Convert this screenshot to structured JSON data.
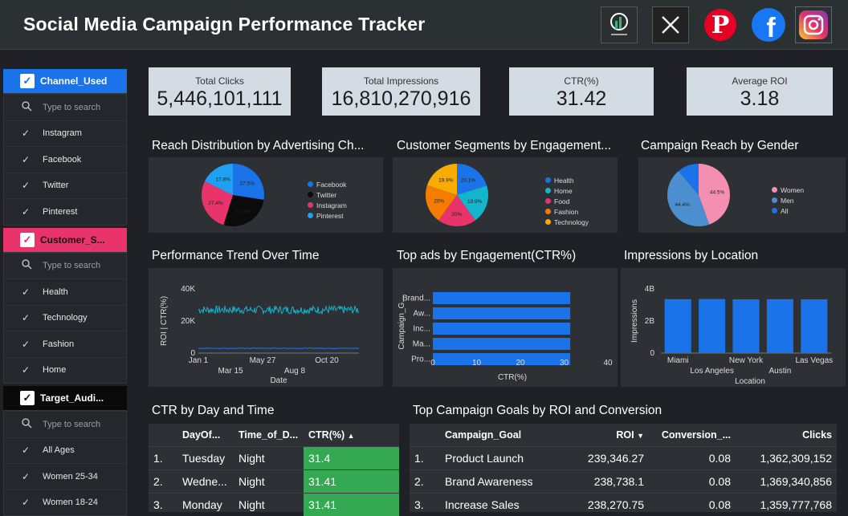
{
  "header": {
    "title": "Social Media Campaign Performance Tracker"
  },
  "filters": [
    {
      "label": "Channel_Used",
      "search_placeholder": "Type to search",
      "items": [
        "Instagram",
        "Facebook",
        "Twitter",
        "Pinterest"
      ],
      "color": "#1a73e8"
    },
    {
      "label": "Customer_S...",
      "search_placeholder": "Type to search",
      "items": [
        "Health",
        "Technology",
        "Fashion",
        "Home"
      ],
      "color": "#e8336b"
    },
    {
      "label": "Target_Audi...",
      "search_placeholder": "Type to search",
      "items": [
        "All Ages",
        "Women 25-34",
        "Women 18-24"
      ],
      "color": "#0a0a0a"
    }
  ],
  "kpis": [
    {
      "label": "Total Clicks",
      "value": "5,446,101,111"
    },
    {
      "label": "Total Impressions",
      "value": "16,810,270,916"
    },
    {
      "label": "CTR(%)",
      "value": "31.42"
    },
    {
      "label": "Average ROI",
      "value": "3.18"
    }
  ],
  "sections": {
    "reach_channel": "Reach Distribution by Advertising Ch...",
    "segments": "Customer Segments by Engagement...",
    "gender": "Campaign Reach by Gender",
    "trend": "Performance Trend Over Time",
    "top_ads": "Top ads by Engagement(CTR%)",
    "location": "Impressions by Location",
    "ctr_day": "CTR by Day and Time",
    "goals": "Top Campaign Goals by ROI and Conversion"
  },
  "chart_data": [
    {
      "type": "pie",
      "series": [
        {
          "name": "Facebook",
          "value": 27.5,
          "label": "27.5%",
          "color": "#1a73e8"
        },
        {
          "name": "Twitter",
          "value": 27.4,
          "label": "27.4%",
          "color": "#0b0b0b"
        },
        {
          "name": "Instagram",
          "value": 27.4,
          "label": "27.4%",
          "color": "#e8336b"
        },
        {
          "name": "Pinterest",
          "value": 17.8,
          "label": "17.8%",
          "color": "#1ea1f2"
        }
      ]
    },
    {
      "type": "pie",
      "series": [
        {
          "name": "Health",
          "value": 20.1,
          "label": "20.1%",
          "color": "#1a73e8"
        },
        {
          "name": "Home",
          "value": 19.9,
          "label": "19.9%",
          "color": "#12b5cb"
        },
        {
          "name": "Food",
          "value": 20,
          "label": "20%",
          "color": "#e8336b"
        },
        {
          "name": "Fashion",
          "value": 20,
          "label": "20%",
          "color": "#f57c00"
        },
        {
          "name": "Technology",
          "value": 19.9,
          "label": "19.9%",
          "color": "#f9ab00"
        }
      ]
    },
    {
      "type": "pie",
      "series": [
        {
          "name": "Women",
          "value": 44.5,
          "label": "44.5%",
          "color": "#f48fb1"
        },
        {
          "name": "Men",
          "value": 44.4,
          "label": "44.4%",
          "color": "#4c8fd1"
        },
        {
          "name": "All",
          "value": 11.1,
          "label": "",
          "color": "#1a73e8"
        }
      ]
    },
    {
      "type": "line",
      "xlabel": "Date",
      "ylabel": "ROI | CTR(%)",
      "ylim": [
        0,
        40000
      ],
      "yticks": [
        "0",
        "20K",
        "40K"
      ],
      "xticks_top": [
        "Jan 1",
        "May 27",
        "Oct 20"
      ],
      "xticks_bottom": [
        "Mar 15",
        "Aug 8"
      ],
      "series": [
        {
          "name": "CTR(%)",
          "level": 27000,
          "noise": 2500,
          "color": "#12b5cb"
        },
        {
          "name": "ROI",
          "level": 3000,
          "noise": 300,
          "color": "#1a73e8"
        }
      ]
    },
    {
      "type": "bar",
      "orientation": "horizontal",
      "ylabel": "Campaign_G...",
      "xlabel": "CTR(%)",
      "categories": [
        "Brand...",
        "Aw...",
        "Inc...",
        "Ma...",
        "Pro..."
      ],
      "values": [
        31.4,
        31.4,
        31.4,
        31.4,
        31.4
      ],
      "xlim": [
        0,
        40
      ],
      "xticks": [
        "0",
        "10",
        "20",
        "30",
        "40"
      ],
      "color": "#1a73e8"
    },
    {
      "type": "bar",
      "ylabel": "Impressions",
      "xlabel": "Location",
      "categories": [
        "Miami",
        "Los Angeles",
        "New York",
        "Austin",
        "Las Vegas"
      ],
      "values": [
        3.36,
        3.37,
        3.35,
        3.36,
        3.35
      ],
      "ylim": [
        0,
        4
      ],
      "yticks": [
        "0",
        "2B",
        "4B"
      ],
      "color": "#1a73e8"
    }
  ],
  "ctr_table": {
    "headers": [
      "DayOf...",
      "Time_of_D...",
      "CTR(%)"
    ],
    "rows": [
      {
        "n": "1.",
        "day": "Tuesday",
        "time": "Night",
        "ctr": "31.4"
      },
      {
        "n": "2.",
        "day": "Wedne...",
        "time": "Night",
        "ctr": "31.41"
      },
      {
        "n": "3.",
        "day": "Monday",
        "time": "Night",
        "ctr": "31.41"
      }
    ]
  },
  "goals_table": {
    "headers": [
      "Campaign_Goal",
      "ROI",
      "Conversion_...",
      "Clicks"
    ],
    "rows": [
      {
        "n": "1.",
        "goal": "Product Launch",
        "roi": "239,346.27",
        "conv": "0.08",
        "clicks": "1,362,309,152"
      },
      {
        "n": "2.",
        "goal": "Brand Awareness",
        "roi": "238,738.1",
        "conv": "0.08",
        "clicks": "1,369,340,856"
      },
      {
        "n": "3.",
        "goal": "Increase Sales",
        "roi": "238,270.75",
        "conv": "0.08",
        "clicks": "1,359,777,768"
      }
    ]
  }
}
